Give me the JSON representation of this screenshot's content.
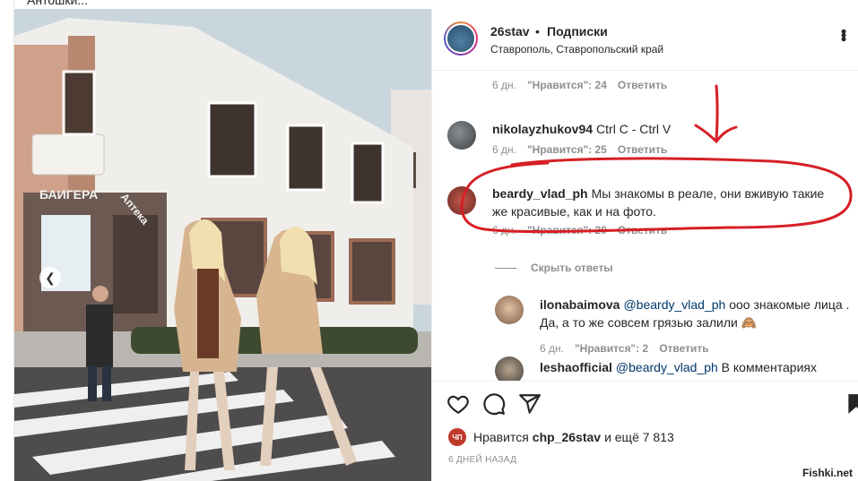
{
  "top_cut_text": "Антошки...",
  "watermark": "Fishki.net",
  "header": {
    "username": "26stav",
    "dot": "•",
    "follow_label": "Подписки",
    "location": "Ставрополь, Ставропольский край",
    "more_icon": "more-dots-icon"
  },
  "photo": {
    "shop_sign": "БАИГЕРА",
    "pharmacy_sign": "Аптека",
    "prev_icon": "chevron-left-icon"
  },
  "comments": {
    "top_meta": {
      "time": "6 дн.",
      "likes": "\"Нравится\": 24",
      "reply": "Ответить"
    },
    "items": [
      {
        "username": "nikolayzhukov94",
        "text": "Ctrl C - Ctrl V",
        "time": "6 дн.",
        "likes": "\"Нравится\": 25",
        "reply": "Ответить"
      },
      {
        "username": "beardy_vlad_ph",
        "text": "Мы знакомы в реале, они вживую такие же красивые, как и на фото.",
        "time": "6 дн.",
        "likes": "\"Нравится\": 20",
        "reply": "Ответить"
      }
    ],
    "hide_replies": "Скрыть ответы",
    "replies": [
      {
        "username": "ilonabaimova",
        "mention": "@beardy_vlad_ph",
        "text": "ооо знакомые лица . Да, а то же совсем грязью залили 🙈",
        "time": "6 дн.",
        "likes": "\"Нравится\": 2",
        "reply": "Ответить"
      },
      {
        "username": "leshaofficial",
        "mention": "@beardy_vlad_ph",
        "text": "В комментариях"
      }
    ]
  },
  "actions": {
    "like_icon": "heart-icon",
    "comment_icon": "comment-icon",
    "share_icon": "share-icon",
    "save_icon": "bookmark-icon"
  },
  "likes": {
    "avatar_text": "ЧП",
    "prefix": "Нравится",
    "user": "chp_26stav",
    "suffix": "и ещё 7 813"
  },
  "date": "6 ДНЕЙ НАЗАД",
  "colors": {
    "annotation": "#d61f26",
    "link": "#00376b",
    "muted": "#8e8e8e"
  }
}
